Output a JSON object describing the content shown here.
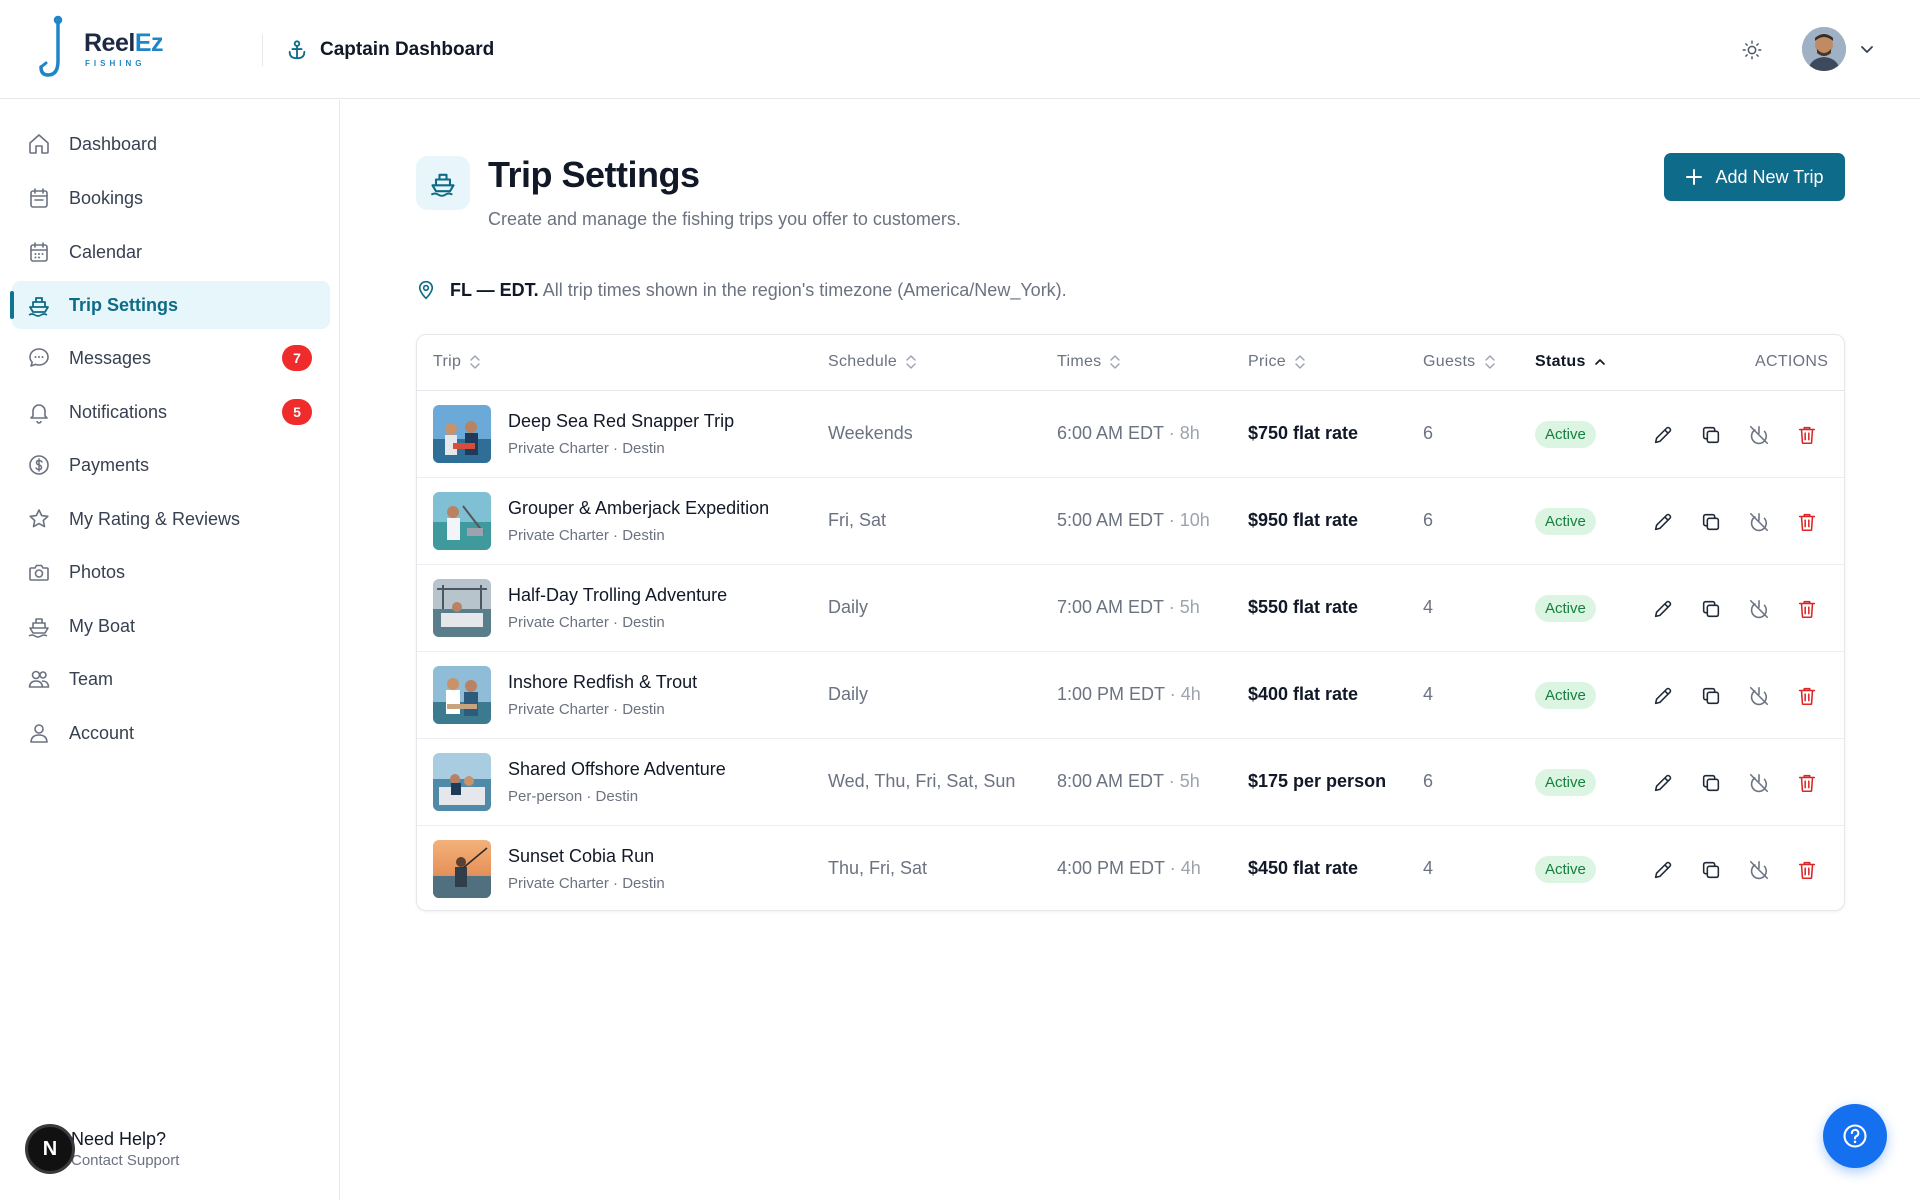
{
  "header": {
    "brand": "Reel",
    "brand_accent": "Ez",
    "brand_sub": "FISHING",
    "title": "Captain Dashboard",
    "icons": {
      "title": "anchor-icon",
      "theme": "sun-icon",
      "menu": "chevron-down-icon"
    }
  },
  "sidebar": {
    "items": [
      {
        "label": "Dashboard",
        "icon": "home-icon"
      },
      {
        "label": "Bookings",
        "icon": "clipboard-icon"
      },
      {
        "label": "Calendar",
        "icon": "calendar-icon"
      },
      {
        "label": "Trip Settings",
        "icon": "ship-icon",
        "active": true
      },
      {
        "label": "Messages",
        "icon": "chat-icon",
        "badge": "7"
      },
      {
        "label": "Notifications",
        "icon": "bell-icon",
        "badge": "5"
      },
      {
        "label": "Payments",
        "icon": "dollar-icon"
      },
      {
        "label": "My Rating & Reviews",
        "icon": "star-icon"
      },
      {
        "label": "Photos",
        "icon": "camera-icon"
      },
      {
        "label": "My Boat",
        "icon": "boat-icon"
      },
      {
        "label": "Team",
        "icon": "users-icon"
      },
      {
        "label": "Account",
        "icon": "user-icon"
      }
    ],
    "help": {
      "avatar_letter": "N",
      "title": "Need Help?",
      "subtitle": "Contact Support"
    }
  },
  "main": {
    "title": "Trip Settings",
    "subtitle": "Create and manage the fishing trips you offer to customers.",
    "add_button": "Add New Trip",
    "timezone": {
      "label": "FL — EDT.",
      "text": "All trip times shown in the region's timezone (America/New_York)."
    },
    "table": {
      "columns": {
        "trip": "Trip",
        "schedule": "Schedule",
        "times": "Times",
        "price": "Price",
        "guests": "Guests",
        "status": "Status",
        "actions": "ACTIONS"
      },
      "rows": [
        {
          "name": "Deep Sea Red Snapper Trip",
          "meta": "Private Charter · Destin",
          "schedule": "Weekends",
          "time": "6:00 AM EDT",
          "duration": "· 8h",
          "price": "$750 flat rate",
          "guests": "6",
          "status": "Active"
        },
        {
          "name": "Grouper & Amberjack Expedition",
          "meta": "Private Charter · Destin",
          "schedule": "Fri, Sat",
          "time": "5:00 AM EDT",
          "duration": "· 10h",
          "price": "$950 flat rate",
          "guests": "6",
          "status": "Active"
        },
        {
          "name": "Half-Day Trolling Adventure",
          "meta": "Private Charter · Destin",
          "schedule": "Daily",
          "time": "7:00 AM EDT",
          "duration": "· 5h",
          "price": "$550 flat rate",
          "guests": "4",
          "status": "Active"
        },
        {
          "name": "Inshore Redfish & Trout",
          "meta": "Private Charter · Destin",
          "schedule": "Daily",
          "time": "1:00 PM EDT",
          "duration": "· 4h",
          "price": "$400 flat rate",
          "guests": "4",
          "status": "Active"
        },
        {
          "name": "Shared Offshore Adventure",
          "meta": "Per-person · Destin",
          "schedule": "Wed, Thu, Fri, Sat, Sun",
          "time": "8:00 AM EDT",
          "duration": "· 5h",
          "price": "$175 per person",
          "guests": "6",
          "status": "Active"
        },
        {
          "name": "Sunset Cobia Run",
          "meta": "Private Charter · Destin",
          "schedule": "Thu, Fri, Sat",
          "time": "4:00 PM EDT",
          "duration": "· 4h",
          "price": "$450 flat rate",
          "guests": "4",
          "status": "Active"
        }
      ]
    }
  },
  "colors": {
    "accent": "#0e6b8a",
    "active_bg": "#e6f6fb",
    "badge": "#ef2b2b",
    "status_bg": "#dcf5e3",
    "status_text": "#15803d",
    "delete": "#dc2626",
    "fab": "#1570ef"
  }
}
